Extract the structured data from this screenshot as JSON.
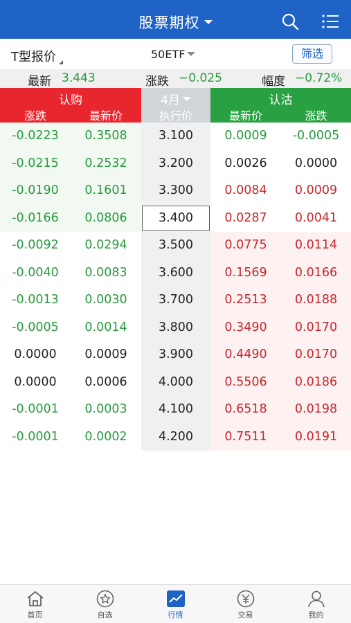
{
  "header": {
    "title": "股票期权"
  },
  "subbar": {
    "t_label": "T型报价",
    "underlying": "50ETF",
    "filter_label": "筛选"
  },
  "quote": {
    "latest_label": "最新",
    "latest_value": "3.443",
    "change_label": "涨跌",
    "change_value": "−0.025",
    "pct_label": "幅度",
    "pct_value": "−0.72%"
  },
  "table_header": {
    "call_title": "认购",
    "call_change": "涨跌",
    "call_price": "最新价",
    "month": "4月",
    "strike": "执行价",
    "put_title": "认沽",
    "put_price": "最新价",
    "put_change": "涨跌"
  },
  "rows": [
    {
      "call_change": "-0.0223",
      "call_price": "0.3508",
      "strike": "3.100",
      "put_price": "0.0009",
      "put_change": "-0.0005"
    },
    {
      "call_change": "-0.0215",
      "call_price": "0.2532",
      "strike": "3.200",
      "put_price": "0.0026",
      "put_change": "0.0000"
    },
    {
      "call_change": "-0.0190",
      "call_price": "0.1601",
      "strike": "3.300",
      "put_price": "0.0084",
      "put_change": "0.0009"
    },
    {
      "call_change": "-0.0166",
      "call_price": "0.0806",
      "strike": "3.400",
      "put_price": "0.0287",
      "put_change": "0.0041"
    },
    {
      "call_change": "-0.0092",
      "call_price": "0.0294",
      "strike": "3.500",
      "put_price": "0.0775",
      "put_change": "0.0114"
    },
    {
      "call_change": "-0.0040",
      "call_price": "0.0083",
      "strike": "3.600",
      "put_price": "0.1569",
      "put_change": "0.0166"
    },
    {
      "call_change": "-0.0013",
      "call_price": "0.0030",
      "strike": "3.700",
      "put_price": "0.2513",
      "put_change": "0.0188"
    },
    {
      "call_change": "-0.0005",
      "call_price": "0.0014",
      "strike": "3.800",
      "put_price": "0.3490",
      "put_change": "0.0170"
    },
    {
      "call_change": "0.0000",
      "call_price": "0.0009",
      "strike": "3.900",
      "put_price": "0.4490",
      "put_change": "0.0170"
    },
    {
      "call_change": "0.0000",
      "call_price": "0.0006",
      "strike": "4.000",
      "put_price": "0.5506",
      "put_change": "0.0186"
    },
    {
      "call_change": "-0.0001",
      "call_price": "0.0003",
      "strike": "4.100",
      "put_price": "0.6518",
      "put_change": "0.0198"
    },
    {
      "call_change": "-0.0001",
      "call_price": "0.0002",
      "strike": "4.200",
      "put_price": "0.7511",
      "put_change": "0.0191"
    }
  ],
  "nav": {
    "home": "首页",
    "watchlist": "自选",
    "market": "行情",
    "trade": "交易",
    "mine": "我的"
  },
  "colors": {
    "brand_blue": "#1f63c6",
    "call_red": "#e8262e",
    "put_green": "#29a142",
    "down_green": "#2a9a3f",
    "up_red": "#c8262b"
  }
}
